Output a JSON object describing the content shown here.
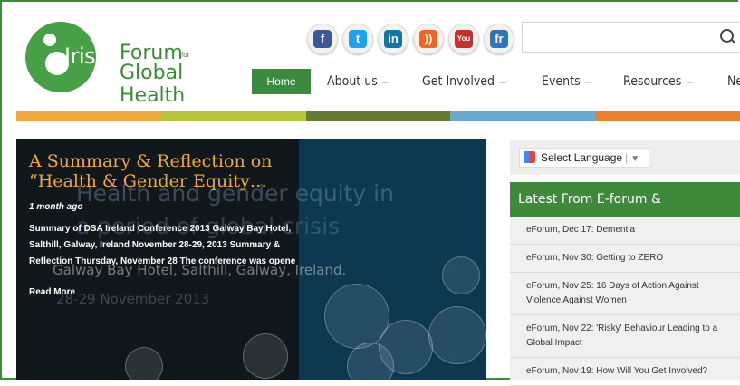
{
  "logo": {
    "irish": "Irish",
    "forum": "Forum",
    "for": "for",
    "global_health": "Global Health",
    "color": "#3c8a3a"
  },
  "social": [
    {
      "name": "facebook-icon",
      "glyph": "f",
      "color": "#3b5998"
    },
    {
      "name": "twitter-icon",
      "glyph": "t",
      "color": "#1da1f2"
    },
    {
      "name": "linkedin-icon",
      "glyph": "in",
      "color": "#0e76a8"
    },
    {
      "name": "rss-icon",
      "glyph": "))",
      "color": "#f26522"
    },
    {
      "name": "youtube-icon",
      "glyph": "You",
      "color": "#c4302b"
    },
    {
      "name": "friendfeed-icon",
      "glyph": "fr",
      "color": "#2f72c4"
    }
  ],
  "search": {
    "placeholder": ""
  },
  "nav": {
    "home": "Home",
    "items": [
      "About us",
      "Get Involved",
      "Events",
      "Resources",
      "News"
    ],
    "caret": "—"
  },
  "colorbar": [
    "#f2a83a",
    "#b6c63c",
    "#647a36",
    "#6ba8d2",
    "#e8812f"
  ],
  "slider": {
    "title": "A Summary & Reflection on “Health & Gender Equity…",
    "date": "1 month ago",
    "excerpt": "Summary of DSA Ireland Conference 2013 Galway Bay Hotel, Salthill, Galway, Ireland November 28-29, 2013 Summary & Reflection  Thursday, November 28 The conference was opene",
    "read_more": "Read More",
    "image_text_1": "Health and gender equity in",
    "image_text_2": "a period of global crisis",
    "image_text_3": "Galway Bay Hotel, Salthill, Galway, Ireland.",
    "image_text_4": "28-29 November 2013"
  },
  "translate": {
    "label": "Select Language",
    "arrow": "▼"
  },
  "latest": {
    "heading": "Latest From E-forum & Newsletters",
    "items": [
      "eForum, Dec 17: Dementia",
      "eForum, Nov 30: Getting to ZERO",
      "eForum, Nov 25: 16 Days of Action Against Violence Against Women",
      "eForum, Nov 22: 'Risky' Behaviour Leading to a Global Impact",
      "eForum, Nov 19: How Will You Get Involved?"
    ]
  }
}
